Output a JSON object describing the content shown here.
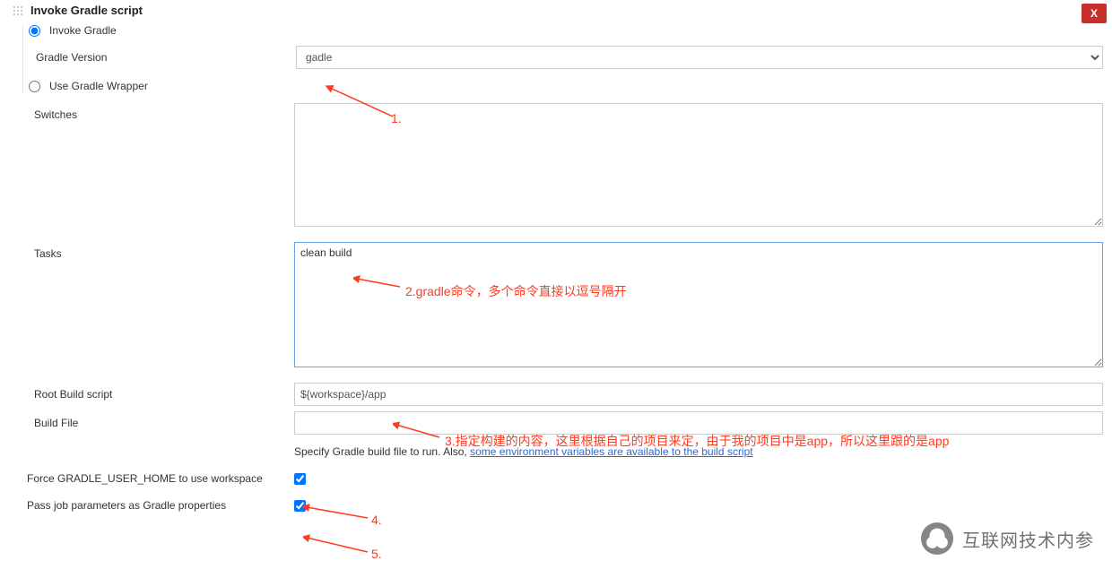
{
  "section": {
    "title": "Invoke Gradle script"
  },
  "closeLabel": "X",
  "radios": {
    "invokeGradle": {
      "label": "Invoke Gradle",
      "checked": true
    },
    "useWrapper": {
      "label": "Use Gradle Wrapper",
      "checked": false
    }
  },
  "labels": {
    "gradleVersion": "Gradle Version",
    "switches": "Switches",
    "tasks": "Tasks",
    "rootBuildScript": "Root Build script",
    "buildFile": "Build File",
    "forceHome": "Force GRADLE_USER_HOME to use workspace",
    "passParams": "Pass job parameters as Gradle properties"
  },
  "fields": {
    "gradleVersionValue": "gadle",
    "switchesValue": "",
    "tasksValue": "clean build",
    "rootBuildScriptValue": "${workspace}/app",
    "buildFileValue": ""
  },
  "helpText": {
    "prefix": "Specify Gradle build file to run. Also, ",
    "link": "some environment variables are available to the build script"
  },
  "checkboxes": {
    "forceHome": true,
    "passParams": true
  },
  "annotations": {
    "a1": "1.",
    "a2": "2.gradle命令，多个命令直接以逗号隔开",
    "a3": "3.指定构建的内容，这里根据自己的项目来定，由于我的项目中是app，所以这里跟的是app",
    "a4": "4.",
    "a5": "5."
  },
  "watermark": "互联网技术内参"
}
